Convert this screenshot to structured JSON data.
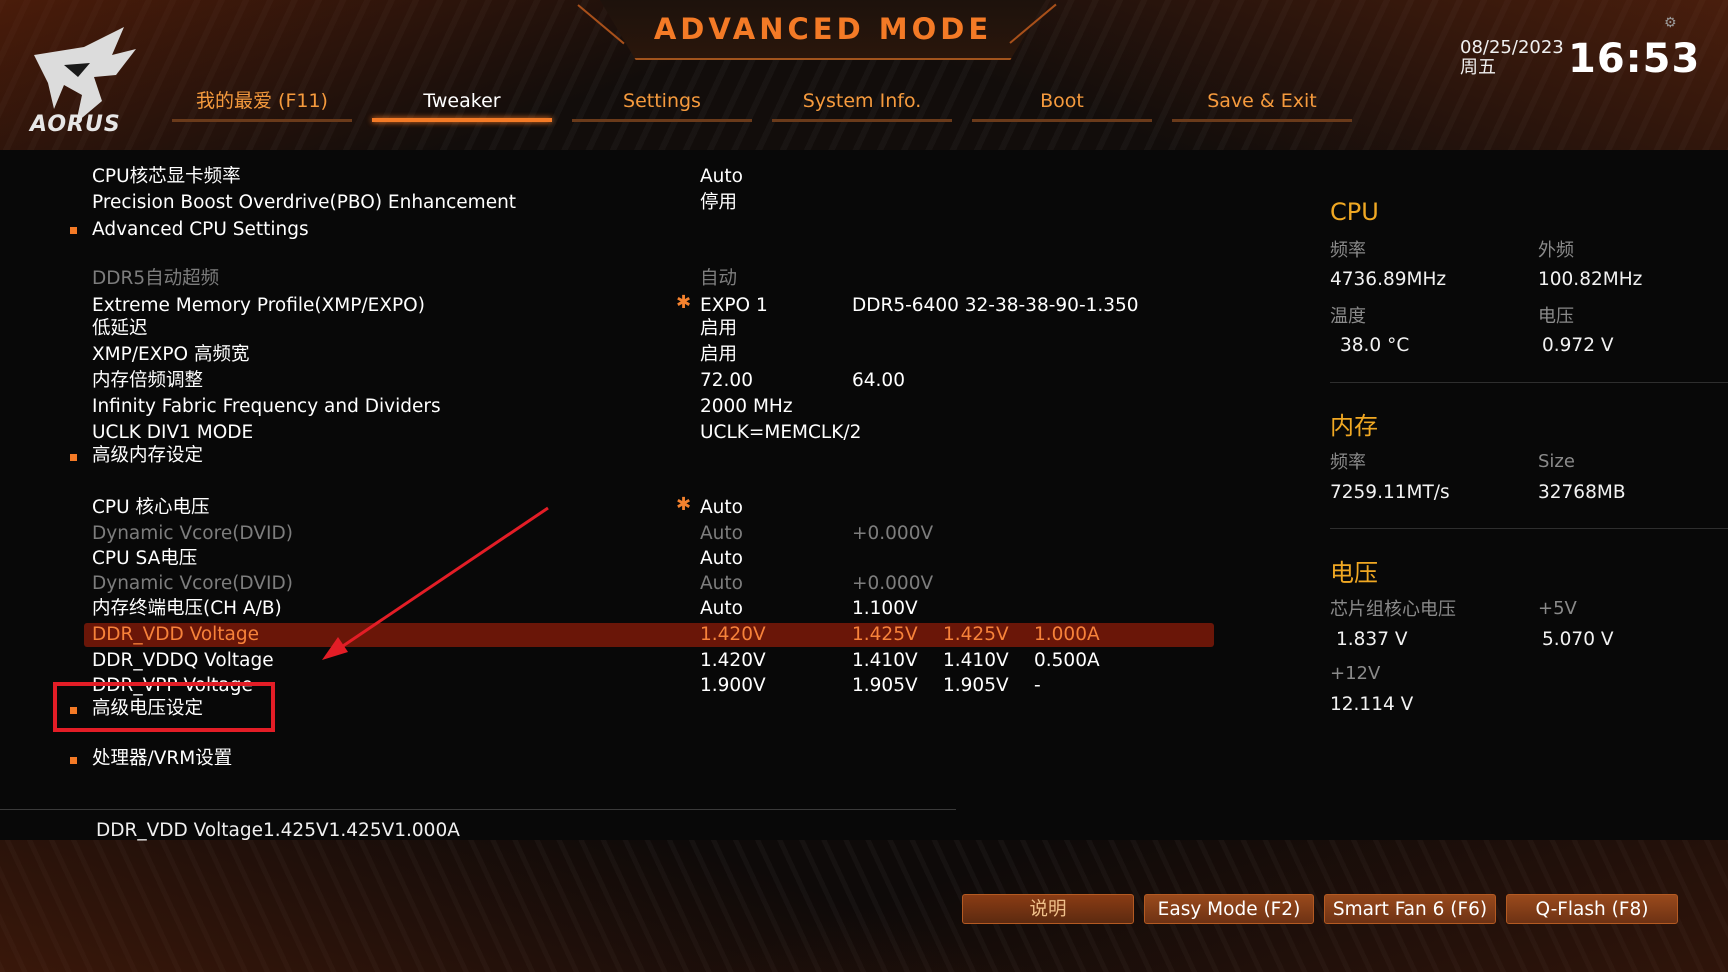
{
  "header": {
    "title": "ADVANCED MODE",
    "brand": "AORUS",
    "date": "08/25/2023",
    "weekday": "周五",
    "time": "16:53",
    "tabs": [
      {
        "label": "我的最爱 (F11)",
        "active": false
      },
      {
        "label": "Tweaker",
        "active": true
      },
      {
        "label": "Settings",
        "active": false
      },
      {
        "label": "System Info.",
        "active": false
      },
      {
        "label": "Boot",
        "active": false
      },
      {
        "label": "Save & Exit",
        "active": false
      }
    ]
  },
  "settings": [
    {
      "name": "CPU核芯显卡频率",
      "v1": "Auto"
    },
    {
      "name": "Precision Boost Overdrive(PBO) Enhancement",
      "v1": "停用"
    },
    {
      "name": "Advanced CPU Settings",
      "submenu": true
    },
    {
      "name": "DDR5自动超频",
      "v1": "自动",
      "dim": true
    },
    {
      "name": "Extreme Memory Profile(XMP/EXPO)",
      "v1": "EXPO 1",
      "v2": "DDR5-6400 32-38-38-90-1.350",
      "star": true
    },
    {
      "name": "低延迟",
      "v1": "启用"
    },
    {
      "name": "XMP/EXPO 高频宽",
      "v1": "启用"
    },
    {
      "name": "内存倍频调整",
      "v1": "72.00",
      "v2": "64.00"
    },
    {
      "name": "Infinity Fabric Frequency and Dividers",
      "v1": "2000 MHz"
    },
    {
      "name": "UCLK DIV1 MODE",
      "v1": "UCLK=MEMCLK/2"
    },
    {
      "name": "高级内存设定",
      "submenu": true
    },
    {
      "name": "CPU 核心电压",
      "v1": "Auto",
      "star": true
    },
    {
      "name": "Dynamic Vcore(DVID)",
      "v1": "Auto",
      "v2": "+0.000V",
      "dim": true
    },
    {
      "name": "CPU SA电压",
      "v1": "Auto"
    },
    {
      "name": "Dynamic Vcore(DVID)",
      "v1": "Auto",
      "v2": "+0.000V",
      "dim": true
    },
    {
      "name": "内存终端电压(CH A/B)",
      "v1": "Auto",
      "v2": "1.100V"
    },
    {
      "name": "DDR_VDD Voltage",
      "v1": "1.420V",
      "v2": "1.425V",
      "v3": "1.425V",
      "v4": "1.000A",
      "selected": true
    },
    {
      "name": "DDR_VDDQ Voltage",
      "v1": "1.420V",
      "v2": "1.410V",
      "v3": "1.410V",
      "v4": "0.500A"
    },
    {
      "name": "DDR_VPP Voltage",
      "v1": "1.900V",
      "v2": "1.905V",
      "v3": "1.905V",
      "v4": "-"
    },
    {
      "name": "高级电压设定",
      "submenu": true
    },
    {
      "name": "处理器/VRM设置",
      "submenu": true
    }
  ],
  "help_text": "DDR_VDD Voltage1.425V1.425V1.000A",
  "monitor": {
    "cpu": {
      "heading": "CPU",
      "freq_label": "频率",
      "freq": "4736.89MHz",
      "bclk_label": "外频",
      "bclk": "100.82MHz",
      "temp_label": "温度",
      "temp": "38.0 °C",
      "volt_label": "电压",
      "volt": "0.972 V"
    },
    "memory": {
      "heading": "内存",
      "freq_label": "频率",
      "freq": "7259.11MT/s",
      "size_label": "Size",
      "size": "32768MB"
    },
    "voltage": {
      "heading": "电压",
      "chipset_label": "芯片组核心电压",
      "chipset": "1.837 V",
      "p5v_label": "+5V",
      "p5v": "5.070 V",
      "p12v_label": "+12V",
      "p12v": "12.114 V"
    }
  },
  "footer": {
    "help_button": "说明",
    "easy_mode": "Easy Mode (F2)",
    "smart_fan": "Smart Fan 6 (F6)",
    "qflash": "Q-Flash (F8)"
  },
  "colors": {
    "accent": "#f47a26",
    "selected_row_bg": "#6a1608",
    "heading_yellow": "#f0a823",
    "annotation_red": "#e31d26"
  }
}
